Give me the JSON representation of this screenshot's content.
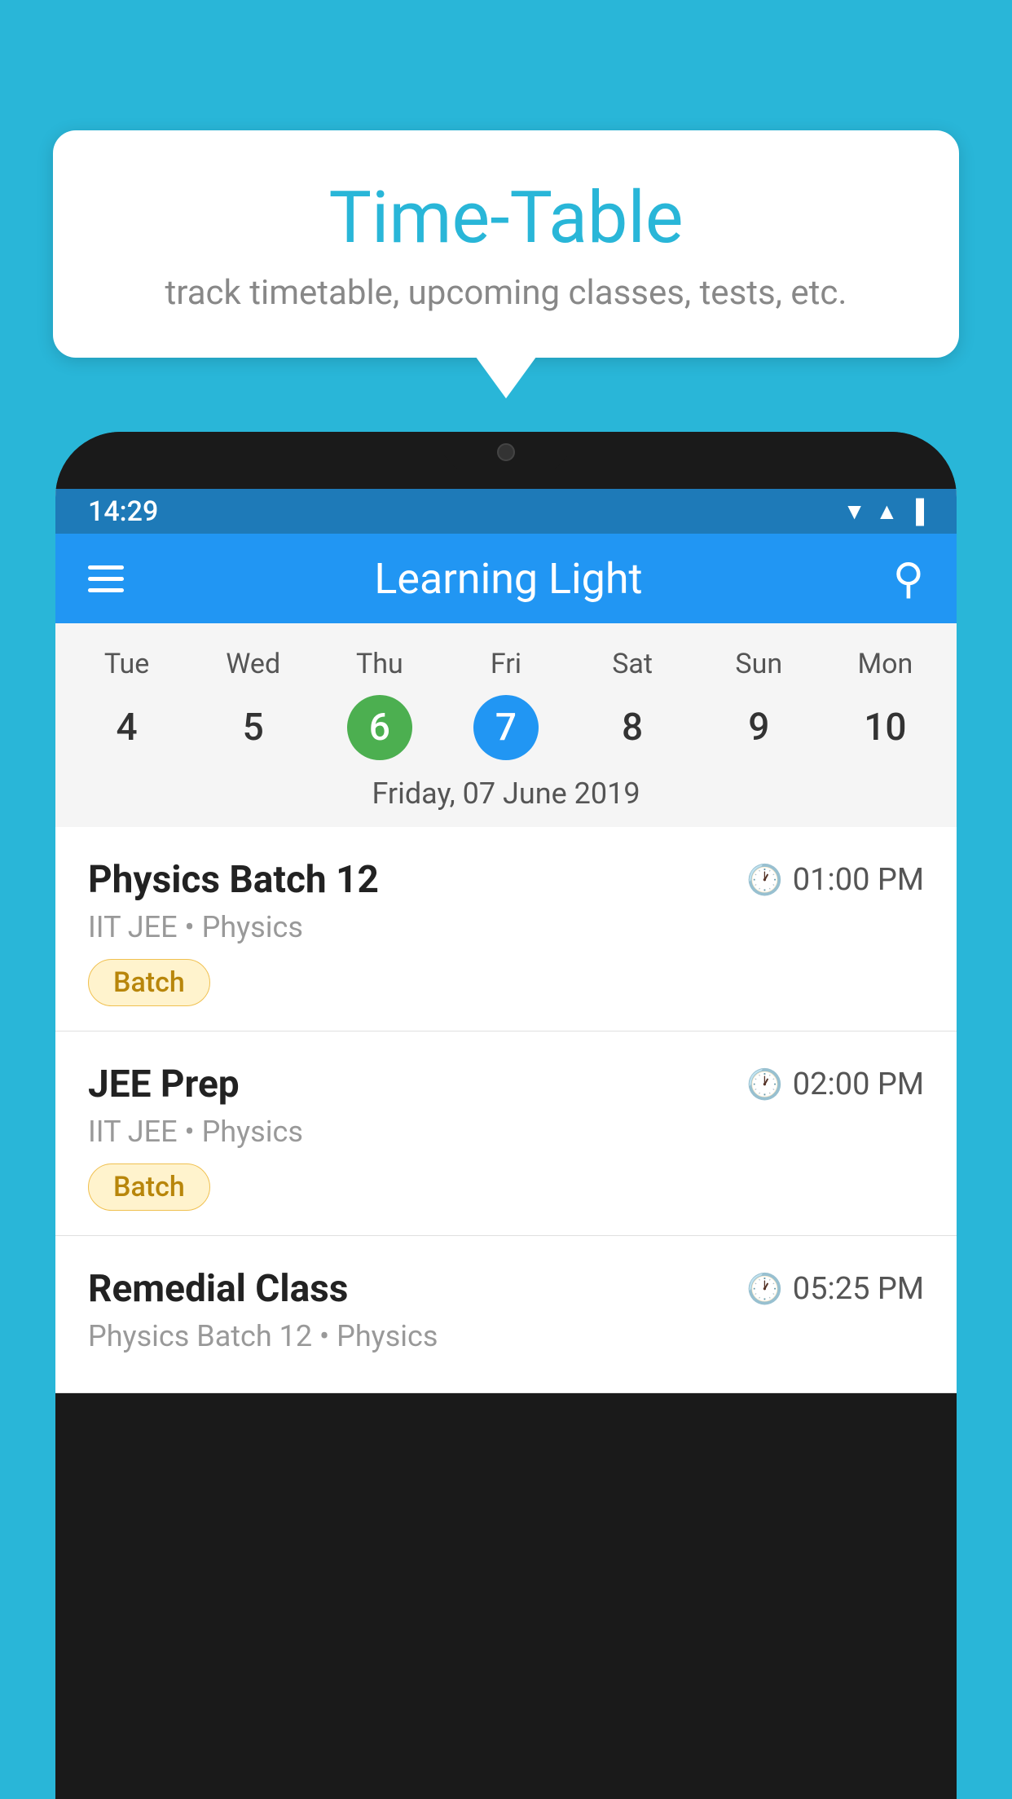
{
  "background_color": "#29b6d8",
  "tooltip": {
    "title": "Time-Table",
    "subtitle": "track timetable, upcoming classes, tests, etc."
  },
  "phone": {
    "status_bar": {
      "time": "14:29",
      "icons": [
        "wifi",
        "signal",
        "battery"
      ]
    },
    "app_header": {
      "title": "Learning Light",
      "menu_label": "Menu",
      "search_label": "Search"
    },
    "calendar": {
      "days": [
        "Tue",
        "Wed",
        "Thu",
        "Fri",
        "Sat",
        "Sun",
        "Mon"
      ],
      "dates": [
        "4",
        "5",
        "6",
        "7",
        "8",
        "9",
        "10"
      ],
      "today_index": 2,
      "selected_index": 3,
      "selected_date_label": "Friday, 07 June 2019"
    },
    "schedule": [
      {
        "title": "Physics Batch 12",
        "time": "01:00 PM",
        "subtitle": "IIT JEE • Physics",
        "badge": "Batch"
      },
      {
        "title": "JEE Prep",
        "time": "02:00 PM",
        "subtitle": "IIT JEE • Physics",
        "badge": "Batch"
      },
      {
        "title": "Remedial Class",
        "time": "05:25 PM",
        "subtitle": "Physics Batch 12 • Physics",
        "badge": null
      }
    ]
  }
}
